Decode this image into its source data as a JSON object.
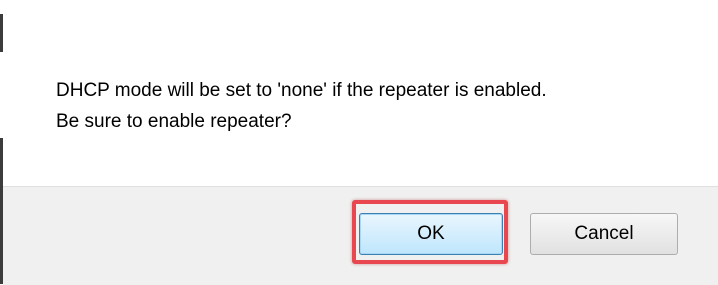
{
  "dialog": {
    "message_line1": "DHCP mode will be set to 'none' if the repeater is enabled.",
    "message_line2": "Be sure to enable repeater?"
  },
  "buttons": {
    "ok_label": "OK",
    "cancel_label": "Cancel"
  },
  "colors": {
    "highlight": "#e8474f",
    "button_bar": "#f0f0f0",
    "ok_border": "#3c7fb1"
  }
}
